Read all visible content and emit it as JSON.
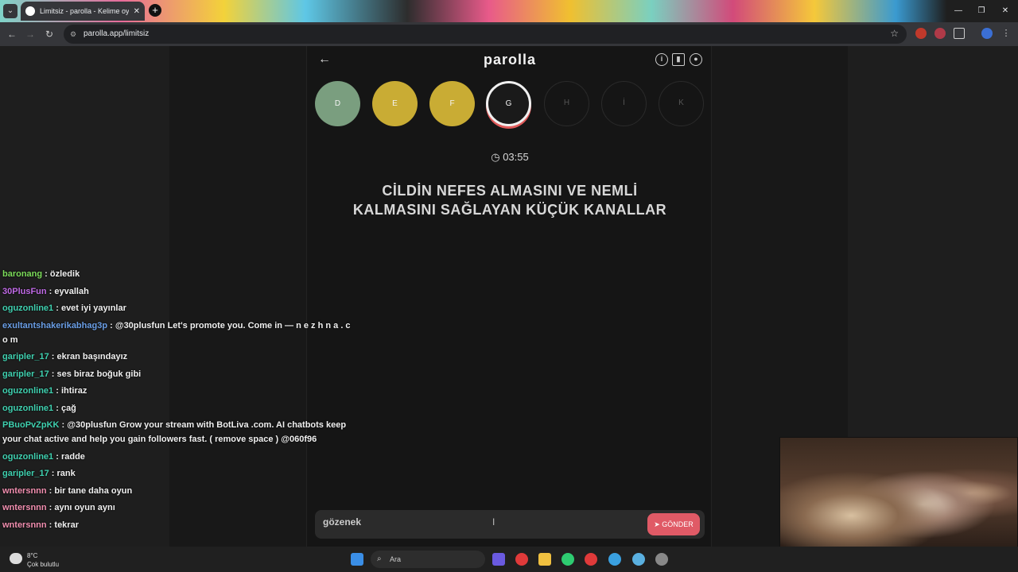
{
  "browser": {
    "tab_title": "Limitsiz - parolla - Kelime oyunu",
    "url": "parolla.app/limitsiz",
    "new_tab": "+",
    "window_controls": [
      "—",
      "❐",
      "✕"
    ]
  },
  "game": {
    "brand": "parolla",
    "letters": [
      {
        "char": "D",
        "state": "correct"
      },
      {
        "char": "E",
        "state": "passed"
      },
      {
        "char": "F",
        "state": "passed"
      },
      {
        "char": "G",
        "state": "active"
      },
      {
        "char": "H",
        "state": "future"
      },
      {
        "char": "İ",
        "state": "future"
      },
      {
        "char": "K",
        "state": "future"
      }
    ],
    "timer": "03:55",
    "clue": "CİLDİN NEFES ALMASINI VE NEMLİ KALMASINI SAĞLAYAN KÜÇÜK KANALLAR",
    "answer_value": "gözenek",
    "send_label": "GÖNDER",
    "colors": {
      "correct": "#7a9e7f",
      "passed": "#c9ac34",
      "active_ring": "#e05a5a",
      "send": "#e05a66"
    }
  },
  "chat": [
    {
      "user": "baronang",
      "color": "#7cdc5a",
      "text": " : özledik"
    },
    {
      "user": "30PlusFun",
      "color": "#c06ae6",
      "text": " : eyvallah"
    },
    {
      "user": "oguzonline1",
      "color": "#3fd1b0",
      "text": " : evet iyi yayınlar"
    },
    {
      "user": "exultantshakerikabhag3p",
      "color": "#6a9ee6",
      "text": " : @30plusfun Let's promote you. Come in — n e z h n a . c o m"
    },
    {
      "user": "garipler_17",
      "color": "#3fd1b0",
      "text": " : ekran başındayız"
    },
    {
      "user": "garipler_17",
      "color": "#3fd1b0",
      "text": " : ses biraz boğuk gibi"
    },
    {
      "user": "oguzonline1",
      "color": "#3fd1b0",
      "text": " : ihtiraz"
    },
    {
      "user": "oguzonline1",
      "color": "#3fd1b0",
      "text": " : çağ"
    },
    {
      "user": "PBuoPvZpKK",
      "color": "#3fd1b0",
      "text": " : @30plusfun Grow your stream with BotLiva .com. AI chatbots keep your chat active and help you gain followers fast. ( remove space ) @060f96"
    },
    {
      "user": "oguzonline1",
      "color": "#3fd1b0",
      "text": " : radde"
    },
    {
      "user": "garipler_17",
      "color": "#3fd1b0",
      "text": " : rank"
    },
    {
      "user": "wntersnnn",
      "color": "#f28fb0",
      "text": " : bir tane daha oyun"
    },
    {
      "user": "wntersnnn",
      "color": "#f28fb0",
      "text": " : aynı oyun aynı"
    },
    {
      "user": "wntersnnn",
      "color": "#f28fb0",
      "text": " : tekrar"
    }
  ],
  "taskbar": {
    "weather_temp": "8°C",
    "weather_desc": "Çok bulutlu",
    "search_label": "Ara"
  }
}
